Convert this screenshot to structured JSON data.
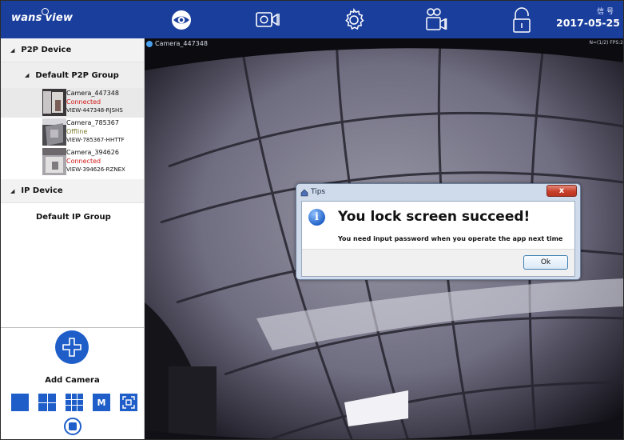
{
  "app": {
    "logo_text_left": "wans",
    "logo_text_right": "iew",
    "clock": "信 号",
    "date": "2017-05-25"
  },
  "toolbar": {
    "icons": [
      "eye-icon",
      "camera-view-icon",
      "gear-icon",
      "recording-icon",
      "lock-icon"
    ]
  },
  "tree": {
    "p2p_device": "P2P Device",
    "p2p_group": "Default P2P Group",
    "cameras": [
      {
        "name": "Camera_447348",
        "status": "Connected",
        "uid": "VIEW-447348-RJSHS"
      },
      {
        "name": "Camera_785367",
        "status": "Offline",
        "uid": "VIEW-785367-HHTTF"
      },
      {
        "name": "Camera_394626",
        "status": "Connected",
        "uid": "VIEW-394626-RZNEX"
      }
    ],
    "ip_device": "IP Device",
    "ip_group": "Default IP Group"
  },
  "controls": {
    "add_camera": "Add Camera",
    "layout_m": "M"
  },
  "video": {
    "title": "Camera_447348",
    "stats": "N=(1/2) FPS:2"
  },
  "dialog": {
    "title": "Tips",
    "close": "x",
    "heading": "You lock screen succeed!",
    "message": "You need input password when you operate the app next time",
    "ok": "Ok"
  },
  "colors": {
    "topbar": "#1a3e9c",
    "accent": "#1f5ec9",
    "connected": "#d21b1b",
    "offline": "#7d7a2d"
  }
}
